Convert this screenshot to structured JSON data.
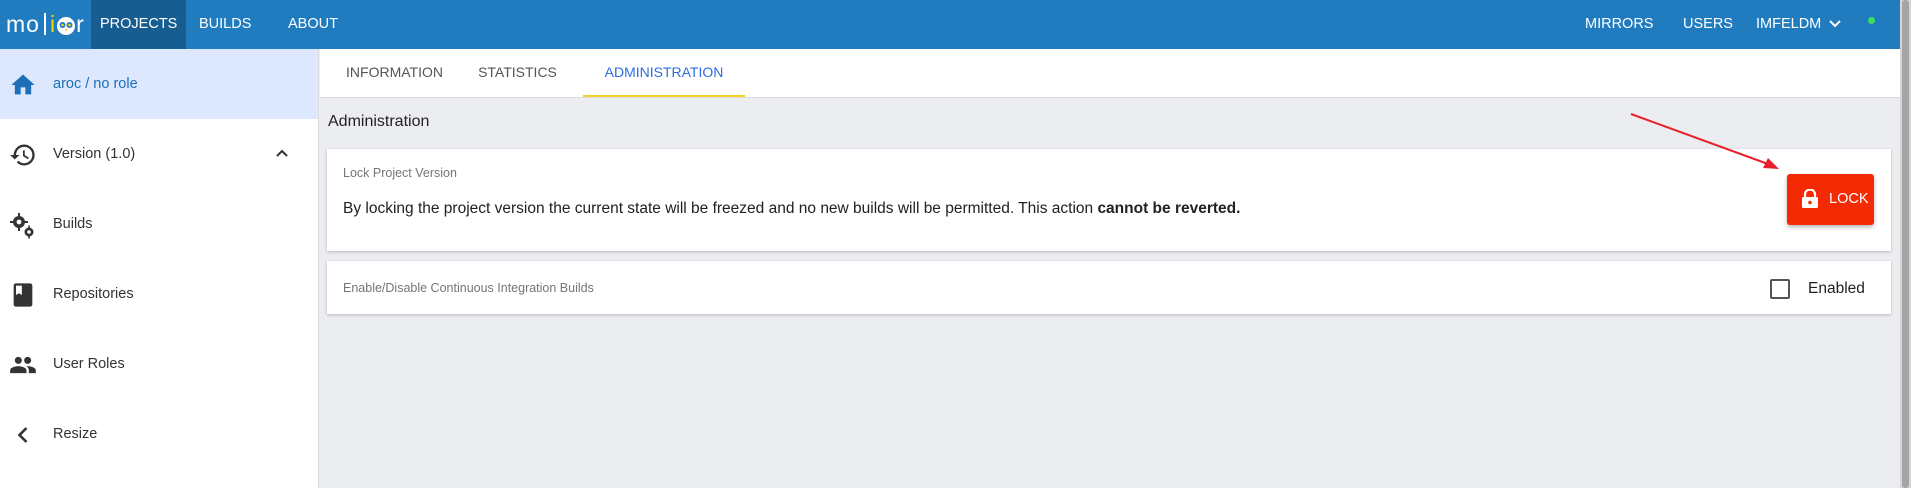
{
  "header": {
    "logo": {
      "part1": "mo",
      "i": "i",
      "part2": "r"
    },
    "nav": [
      "PROJECTS",
      "BUILDS",
      "ABOUT"
    ],
    "right_nav": [
      "MIRRORS",
      "USERS",
      "IMFELDM"
    ]
  },
  "sidebar": {
    "items": [
      {
        "label": "aroc / no role",
        "icon": "home-icon"
      },
      {
        "label": "Version (1.0)",
        "icon": "history-icon"
      },
      {
        "label": "Builds",
        "icon": "gears-icon"
      },
      {
        "label": "Repositories",
        "icon": "book-icon"
      },
      {
        "label": "User Roles",
        "icon": "people-icon"
      },
      {
        "label": "Resize",
        "icon": "chevron-left-icon"
      }
    ]
  },
  "tabs": [
    "INFORMATION",
    "STATISTICS",
    "ADMINISTRATION"
  ],
  "main": {
    "section_title": "Administration",
    "lock_card": {
      "caption": "Lock Project Version",
      "text": "By locking the project version the current state will be freezed and no new builds will be permitted. This action ",
      "text_bold": "cannot be reverted.",
      "button_label": "LOCK"
    },
    "ci_card": {
      "caption": "Enable/Disable Continuous Integration Builds",
      "checkbox_label": "Enabled",
      "checked": false
    }
  },
  "colors": {
    "topbar": "#217bbf",
    "lock_button": "#f42a05",
    "active_tab_text": "#2d6de0",
    "active_tab_underline": "#f0d324",
    "annotation_arrow": "#e8202a"
  }
}
